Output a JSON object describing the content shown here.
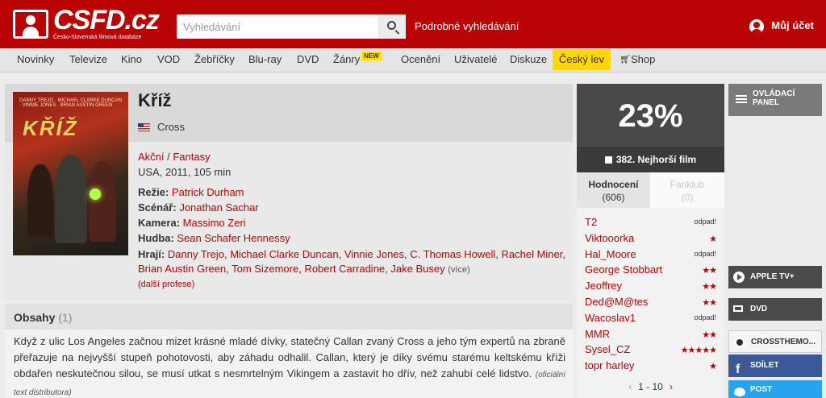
{
  "header": {
    "logo_text": "CSFD.cz",
    "logo_subtitle": "Česko-Slovenská filmová databáze",
    "search_placeholder": "Vyhledávání",
    "advanced_search": "Podrobné vyhledávání",
    "account": "Můj účet"
  },
  "nav": {
    "items": [
      "Novinky",
      "Televize",
      "Kino",
      "VOD",
      "Žebříčky",
      "Blu-ray",
      "DVD",
      "Žánry",
      "Ocenění",
      "Uživatelé",
      "Diskuze",
      "Český lev",
      "Shop"
    ],
    "new_badge": "NEW",
    "shop_icon": "cart-icon"
  },
  "film": {
    "poster_title": "KŘÍŽ",
    "poster_names": "DANNY TREJO · MICHAEL CLARKE DUNCAN · VINNIE JONES · BRIAN AUSTIN GREEN",
    "title": "Kříž",
    "original_title": "Cross",
    "genre_1": "Akční",
    "genre_sep": " / ",
    "genre_2": "Fantasy",
    "origin": "USA, 2011, 105 min",
    "credits": [
      {
        "label": "Režie:",
        "value": "Patrick Durham"
      },
      {
        "label": "Scénář:",
        "value": "Jonathan Sachar"
      },
      {
        "label": "Kamera:",
        "value": "Massimo Zeri"
      },
      {
        "label": "Hudba:",
        "value": "Sean Schafer Hennessy"
      }
    ],
    "cast_label": "Hrají:",
    "cast": [
      "Danny Trejo",
      "Michael Clarke Duncan",
      "Vinnie Jones",
      "C. Thomas Howell",
      "Rachel Miner",
      "Brian Austin Green",
      "Tom Sizemore",
      "Robert Carradine",
      "Jake Busey"
    ],
    "cast_more": "(více)",
    "more_professions": "(další profese)"
  },
  "plot": {
    "title": "Obsahy",
    "count": "(1)",
    "text": "Když z ulic Los Angeles začnou mizet krásné mladé dívky, statečný Callan zvaný Cross a jeho tým expertů na zbraně přeřazuje na nejvyšší stupeň pohotovosti, aby záhadu odhalil. Callan, který je díky svému starému keltskému kříži obdařen neskutečnou silou, se musí utkat s nesmrtelným Vikingem a zastavit ho dřív, než zahubí celé lidstvo.",
    "source": "(oficiální text distributora)"
  },
  "rating": {
    "percent": "23%",
    "worst_rank": "382. Nejhorší film",
    "tab_ratings_label": "Hodnocení",
    "tab_ratings_count": "(606)",
    "tab_fanclub_label": "Fanklub",
    "tab_fanclub_count": "(0)",
    "users": [
      {
        "name": "T2",
        "rating": "odpad!"
      },
      {
        "name": "Viktooorka",
        "rating": "★"
      },
      {
        "name": "Hal_Moore",
        "rating": "odpad!"
      },
      {
        "name": "George Stobbart",
        "rating": "★★"
      },
      {
        "name": "Jeoffrey",
        "rating": "★★"
      },
      {
        "name": "Ded@M@tes",
        "rating": "★★"
      },
      {
        "name": "Wacoslav1",
        "rating": "odpad!"
      },
      {
        "name": "MMR",
        "rating": "★★"
      },
      {
        "name": "Sysel_CZ",
        "rating": "★★★★★"
      },
      {
        "name": "topr harley",
        "rating": "★"
      }
    ],
    "pager": "1 - 10",
    "accent": "#ba0305"
  },
  "side": {
    "control_panel_1": "OVLÁDACÍ",
    "control_panel_2": "PANEL",
    "apple_tv": "APPLE TV+",
    "dvd": "DVD",
    "crossthemo": "CROSSTHEMO...",
    "share": "SDÍLET",
    "post": "POST"
  }
}
